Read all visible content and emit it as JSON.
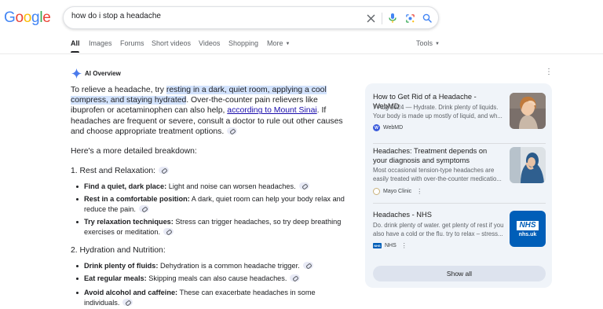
{
  "logo": {
    "letters": [
      "G",
      "o",
      "o",
      "g",
      "l",
      "e"
    ],
    "colors": [
      "#4285F4",
      "#EA4335",
      "#FBBC05",
      "#4285F4",
      "#34A853",
      "#EA4335"
    ]
  },
  "search": {
    "query": "how do i stop a headache"
  },
  "tabs": [
    {
      "label": "All",
      "active": true
    },
    {
      "label": "Images"
    },
    {
      "label": "Forums"
    },
    {
      "label": "Short videos"
    },
    {
      "label": "Videos"
    },
    {
      "label": "Shopping"
    },
    {
      "label": "More"
    }
  ],
  "tools_label": "Tools",
  "ai_overview": {
    "title": "AI Overview",
    "intro_prefix": "To relieve a headache, try ",
    "intro_highlight": "resting in a dark, quiet room, applying a cool compress, and staying hydrated",
    "intro_mid": ". Over-the-counter pain relievers like ibuprofen or acetaminophen can also help, ",
    "intro_link": "according to Mount Sinai",
    "intro_suffix": ". If headaches are frequent or severe, consult a doctor to rule out other causes and choose appropriate treatment options.",
    "breakdown": "Here's a more detailed breakdown:",
    "sections": [
      {
        "heading": "1. Rest and Relaxation:",
        "bullets": [
          {
            "bold": "Find a quiet, dark place:",
            "text": " Light and noise can worsen headaches."
          },
          {
            "bold": "Rest in a comfortable position:",
            "text": " A dark, quiet room can help your body relax and reduce the pain."
          },
          {
            "bold": "Try relaxation techniques:",
            "text": " Stress can trigger headaches, so try deep breathing exercises or meditation."
          }
        ]
      },
      {
        "heading": "2. Hydration and Nutrition:",
        "bullets": [
          {
            "bold": "Drink plenty of fluids:",
            "text": " Dehydration is a common headache trigger."
          },
          {
            "bold": "Eat regular meals:",
            "text": " Skipping meals can also cause headaches."
          },
          {
            "bold": "Avoid alcohol and caffeine:",
            "text": " These can exacerbate headaches in some individuals."
          }
        ]
      }
    ]
  },
  "sources": [
    {
      "title": "How to Get Rid of a Headache - WebMD",
      "snippet": "7 Aug 2024 — Hydrate. Drink plenty of liquids. Your body is made up mostly of liquid, and wh...",
      "site": "WebMD",
      "favicon_text": "W",
      "favicon_color": "#3b5bdb"
    },
    {
      "title": "Headaches: Treatment depends on your diagnosis and symptoms",
      "snippet": "Most occasional tension-type headaches are easily treated with over-the-counter medicatio...",
      "site": "Mayo Clinic",
      "favicon_text": "",
      "favicon_color": "#ffffff"
    },
    {
      "title": "Headaches - NHS",
      "snippet": "Do. drink plenty of water. get plenty of rest if you also have a cold or the flu. try to relax – stress...",
      "site": "NHS",
      "favicon_text": "NHS",
      "favicon_color": "#005eb8",
      "thumb_text": [
        "NHS",
        "nhs.uk"
      ]
    }
  ],
  "show_all_label": "Show all"
}
